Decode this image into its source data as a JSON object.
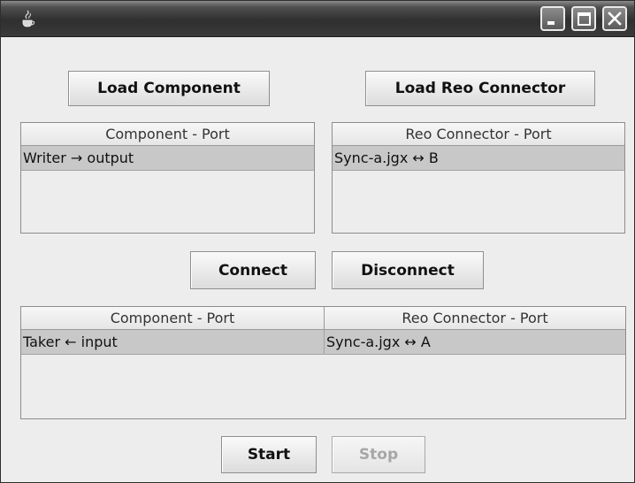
{
  "window": {
    "icon": "java-cup-icon",
    "controls": [
      "minimize-icon",
      "maximize-icon",
      "close-icon"
    ]
  },
  "buttons": {
    "load_component": "Load Component",
    "load_reo_connector": "Load Reo Connector",
    "connect": "Connect",
    "disconnect": "Disconnect",
    "start": "Start",
    "stop": "Stop"
  },
  "component_table": {
    "header": "Component - Port",
    "rows": [
      "Writer → output"
    ]
  },
  "connector_table": {
    "header": "Reo Connector - Port",
    "rows": [
      "Sync-a.jgx ↔ B"
    ]
  },
  "connections_table": {
    "headers": [
      "Component - Port",
      "Reo Connector - Port"
    ],
    "rows": [
      [
        "Taker ← input",
        "Sync-a.jgx ↔ A"
      ]
    ]
  }
}
